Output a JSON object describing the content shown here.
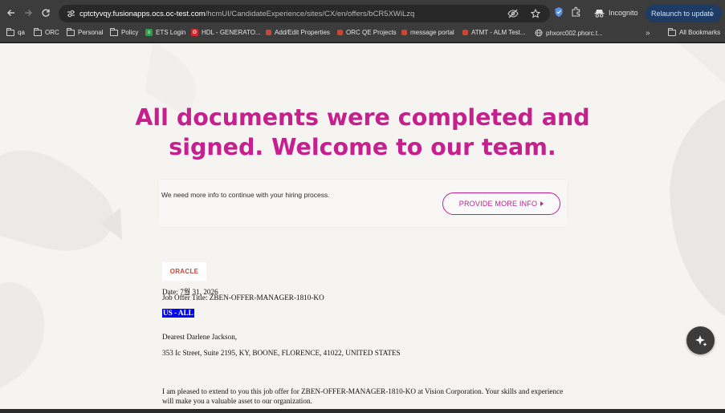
{
  "browser": {
    "url_host": "cptctyvqy.fusionapps.ocs.oc-test.com",
    "url_path": "/hcmUI/CandidateExperience/sites/CX/en/offers/bCR5XWiLzq",
    "incognito_label": "Incognito",
    "relaunch_label": "Relaunch to update"
  },
  "bookmarks": [
    {
      "label": "qa",
      "icon": "folder-icon"
    },
    {
      "label": "ORC",
      "icon": "folder-icon"
    },
    {
      "label": "Personal",
      "icon": "folder-icon"
    },
    {
      "label": "Policy",
      "icon": "folder-icon"
    },
    {
      "label": "ETS Login",
      "icon": "sheet-icon"
    },
    {
      "label": "HDL - GENERATO...",
      "icon": "app-icon"
    },
    {
      "label": "Add/Edit Properties",
      "icon": "oracle-icon"
    },
    {
      "label": "ORC QE Projects",
      "icon": "oracle-icon"
    },
    {
      "label": "message portal",
      "icon": "oracle-icon"
    },
    {
      "label": "ATMT - ALM Test...",
      "icon": "oracle-icon"
    },
    {
      "label": "phxorc002.phorc.t...",
      "icon": "globe-icon"
    }
  ],
  "all_bookmarks_label": "All Bookmarks",
  "page": {
    "headline": "All documents were completed and signed. Welcome to our team.",
    "info_text": "We need more info to continue with your hiring process.",
    "provide_button": "PROVIDE MORE INFO"
  },
  "letter": {
    "logo_text": "ORACLE",
    "date": "Date: 7월 31, 2026",
    "job_title": "Job Offer Title: ZBEN-OFFER-MANAGER-1810-KO",
    "highlight": "US - ALL",
    "greeting": "Dearest Darlene Jackson,",
    "address": "353 Ic Street, Suite 2195, KY, BOONE, FLORENCE, 41022, UNITED STATES",
    "body": "I am pleased to extend to you this job offer for ZBEN-OFFER-MANAGER-1810-KO at Vision Corporation. Your skills and experience will make you a valuable asset to our organization."
  },
  "colors": {
    "accent": "#c61f8e",
    "page_bg": "#f6f4f1",
    "chrome_bg": "#3c3c3c"
  }
}
